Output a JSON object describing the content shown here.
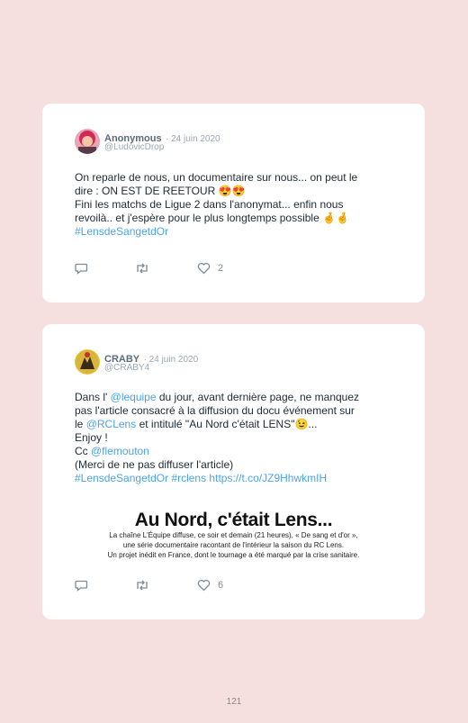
{
  "tweets": [
    {
      "name": "Anonymous",
      "date": "· 24 juin 2020",
      "handle": "@LudovicDrop",
      "lines": [
        "On reparle de nous, un documentaire sur nous... on peut le",
        "dire : ON EST DE REETOUR",
        "Fini les matchs de Ligue 2 dans l'anonymat... enfin nous",
        "revoilà.. et j'espère pour le plus longtemps possible",
        "#LensdeSangetdOr"
      ],
      "emoji1": "😍😍",
      "emoji2": "🤞🤞",
      "actions": {
        "like_count": "2"
      }
    },
    {
      "name": "CRABY",
      "date": "· 24 juin 2020",
      "handle": "@CRABY4",
      "line1_pre": "Dans l' ",
      "line1_link": "@lequipe",
      "line1_post": " du jour, avant dernière page, ne manquez",
      "line2": "pas l'article consacré à la diffusion du docu événement sur",
      "line3_pre": "le ",
      "line3_link": "@RCLens",
      "line3_post": " et intitulé \"Au Nord c'était LENS\"",
      "line3_emoji": "😉",
      "line3_end": "...",
      "line4": "Enjoy !",
      "line5_pre": "Cc ",
      "line5_link": "@flemouton",
      "line6": "(Merci de ne pas diffuser l'article)",
      "line7": "#LensdeSangetdOr #rclens https://t.co/JZ9HhwkmIH",
      "promo": {
        "title": "Au Nord, c'était Lens...",
        "line1": "La chaîne L'Équipe diffuse, ce soir et demain (21 heures), « De sang et d'or »,",
        "line2": "une série documentaire racontant de l'intérieur la saison du RC Lens.",
        "line3": "Un projet inédit en France, dont le tournage a été marqué par la crise sanitaire."
      },
      "actions": {
        "like_count": "6"
      }
    }
  ],
  "page_number": "121",
  "colors": {
    "background": "#f5dfdf",
    "link": "#4aa3e8",
    "icon": "#7d8a96"
  }
}
